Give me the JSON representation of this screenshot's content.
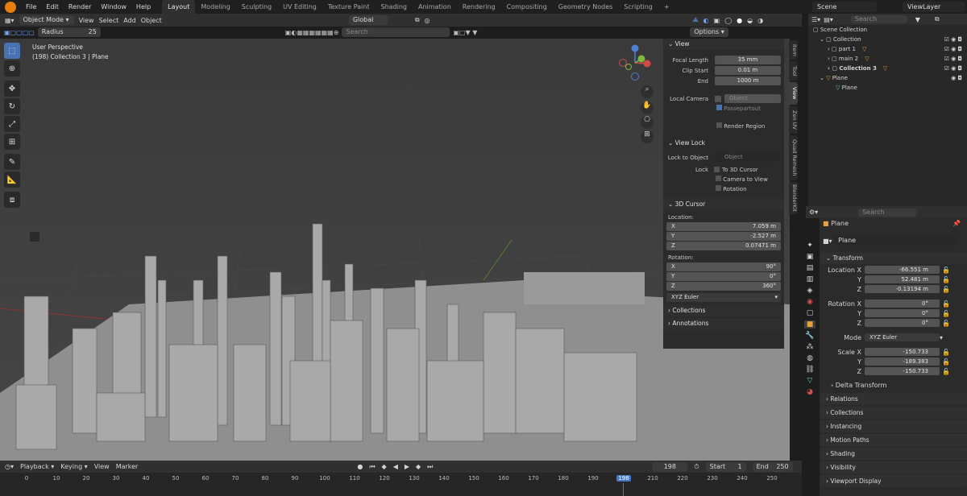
{
  "menu": [
    "File",
    "Edit",
    "Render",
    "Window",
    "Help"
  ],
  "workspaces": [
    "Layout",
    "Modeling",
    "Sculpting",
    "UV Editing",
    "Texture Paint",
    "Shading",
    "Animation",
    "Rendering",
    "Compositing",
    "Geometry Nodes",
    "Scripting"
  ],
  "scene_name": "Scene",
  "view_layer": "ViewLayer",
  "header": {
    "mode": "Object Mode",
    "menus": [
      "View",
      "Select",
      "Add",
      "Object"
    ],
    "orientation": "Global",
    "options": "Options"
  },
  "toolsettings": {
    "radius_label": "Radius",
    "radius_value": "25",
    "search_placeholder": "Search"
  },
  "viewport": {
    "perspective": "User Perspective",
    "collection_info": "(198) Collection 3 | Plane"
  },
  "npanel": {
    "tabs": [
      "Item",
      "Tool",
      "View",
      "Zen UV",
      "Quad Remesh",
      "BlenderKit"
    ],
    "view": {
      "title": "View",
      "focal_label": "Focal Length",
      "focal": "35 mm",
      "clip_start_label": "Clip Start",
      "clip_start": "0.01 m",
      "end_label": "End",
      "end": "1000 m",
      "local_camera": "Local Camera",
      "object_ph": "Object",
      "passepartout": "Passepartout",
      "render_region": "Render Region"
    },
    "view_lock": {
      "title": "View Lock",
      "lock_to_object": "Lock to Object",
      "object_ph": "Object",
      "lock": "Lock",
      "to_cursor": "To 3D Cursor",
      "camera_to_view": "Camera to View",
      "rotation": "Rotation"
    },
    "cursor": {
      "title": "3D Cursor",
      "location": "Location:",
      "x": "7.059 m",
      "y": "-2.527 m",
      "z": "0.07471 m",
      "rotation_label": "Rotation:",
      "rx": "90°",
      "ry": "0°",
      "rz": "360°",
      "mode": "XYZ Euler"
    },
    "collections": "Collections",
    "annotations": "Annotations"
  },
  "outliner": {
    "search": "Search",
    "scene_collection": "Scene Collection",
    "items": [
      {
        "label": "Collection",
        "indent": 1
      },
      {
        "label": "part 1",
        "indent": 2
      },
      {
        "label": "main 2",
        "indent": 2
      },
      {
        "label": "Collection 3",
        "indent": 2
      },
      {
        "label": "Plane",
        "indent": 1
      },
      {
        "label": "Plane",
        "indent": 2
      }
    ]
  },
  "properties": {
    "search": "Search",
    "object_name": "Plane",
    "data_name": "Plane",
    "transform": "Transform",
    "location_label": "Location X",
    "lx": "-66.551 m",
    "ly": "52.481 m",
    "lz": "-0.13194 m",
    "rotation_label": "Rotation X",
    "rx": "0°",
    "ry": "0°",
    "rz": "0°",
    "mode_label": "Mode",
    "mode": "XYZ Euler",
    "scale_label": "Scale X",
    "sx": "-150.733",
    "sy": "-189.383",
    "sz": "-150.733",
    "y": "Y",
    "z": "Z",
    "delta": "Delta Transform",
    "sections": [
      "Relations",
      "Collections",
      "Instancing",
      "Motion Paths",
      "Shading",
      "Visibility",
      "Viewport Display"
    ]
  },
  "timeline": {
    "menus": [
      "Playback",
      "Keying",
      "View",
      "Marker"
    ],
    "current": "198",
    "start_label": "Start",
    "start": "1",
    "end_label": "End",
    "end": "250",
    "ticks": [
      "0",
      "10",
      "20",
      "30",
      "40",
      "50",
      "60",
      "70",
      "80",
      "90",
      "100",
      "110",
      "120",
      "130",
      "140",
      "150",
      "160",
      "170",
      "180",
      "190",
      "198",
      "210",
      "220",
      "230",
      "240",
      "250"
    ]
  },
  "colors": {
    "accent": "#4772b3",
    "active_frame": "#4a7ac7",
    "object_orange": "#e8a03c",
    "mesh_green": "#5fd39a"
  }
}
